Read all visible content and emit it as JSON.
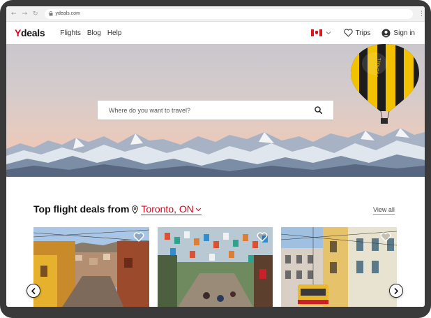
{
  "browser": {
    "url": "ydeals.com",
    "back_icon": "back-arrow-icon",
    "forward_icon": "forward-arrow-icon",
    "reload_icon": "reload-icon",
    "menu_icon": "kebab-menu-icon"
  },
  "header": {
    "logo_mark": "Y",
    "logo_text": "deals",
    "nav": [
      {
        "label": "Flights"
      },
      {
        "label": "Blog"
      },
      {
        "label": "Help"
      }
    ],
    "country_icon": "canada-flag-icon",
    "trips_label": "Trips",
    "signin_label": "Sign in"
  },
  "hero": {
    "search_placeholder": "Where do you want to travel?",
    "balloon_text": "ECK&SCHULL"
  },
  "deals": {
    "title": "Top flight deals from",
    "city": "Toronto, ON",
    "view_all": "View all",
    "cards": [
      {
        "name": "deal-card-cusco",
        "favorite_icon": "heart-icon"
      },
      {
        "name": "deal-card-mexico-city",
        "favorite_icon": "heart-icon"
      },
      {
        "name": "deal-card-lisbon",
        "favorite_icon": "heart-icon"
      }
    ]
  },
  "colors": {
    "brand": "#e0001b",
    "text": "#111111",
    "frame": "#3a3a3a"
  }
}
